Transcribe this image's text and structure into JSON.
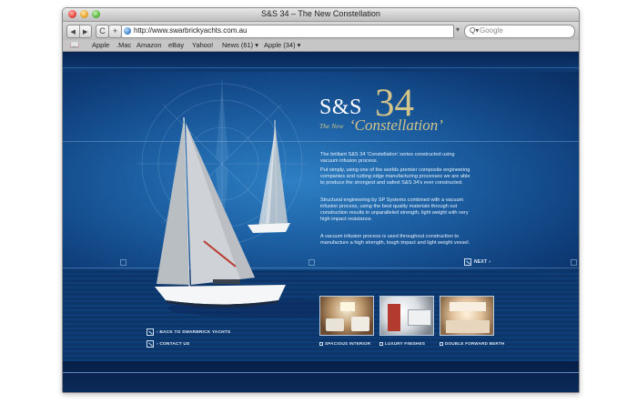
{
  "window": {
    "title": "S&S 34 – The New Constellation"
  },
  "toolbar": {
    "back_icon": "back-arrow-icon",
    "forward_icon": "forward-arrow-icon",
    "refresh_glyph": "C",
    "add_glyph": "+",
    "url": "http://www.swarbrickyachts.com.au",
    "search_placeholder": "Google"
  },
  "bookmarks": [
    {
      "label": "Apple"
    },
    {
      "label": ".Mac"
    },
    {
      "label": "Amazon"
    },
    {
      "label": "eBay"
    },
    {
      "label": "Yahoo!"
    },
    {
      "label": "News (61) ▾"
    },
    {
      "label": "Apple (34) ▾"
    }
  ],
  "hero": {
    "logo_brand": "S&S",
    "logo_number": "34",
    "logo_the_new": "The New",
    "logo_name": "‘Constellation’",
    "paragraphs": [
      "The brilliant S&S 34 ‘Constellation’ series constructed using vacuum infusion process.",
      "Put simply, using one of the worlds premier composite engineering companies and cutting edge manufacturing processes we are able to produce the strongest and safest S&S 34’s ever constructed.",
      "Structural engineering by SP Systems combined with a vacuum infusion process, using the best quality materials through out construction results in unparalleled strength, light weight with very high impact resistance.",
      "A vacuum infusion process is used throughout construction to manufacture a high strength, tough impact and light weight vessel."
    ],
    "next_label": "NEXT ›"
  },
  "links": {
    "back": "‹ BACK TO SWARBRICK YACHTS",
    "contact": "› CONTACT US"
  },
  "thumbnails": [
    {
      "caption": "SPACIOUS INTERIOR"
    },
    {
      "caption": "LUXURY FINISHES"
    },
    {
      "caption": "DOUBLE FORWARD BERTH"
    }
  ],
  "colors": {
    "accent_gold": "#d3c48a",
    "page_blue": "#0e3b73"
  }
}
